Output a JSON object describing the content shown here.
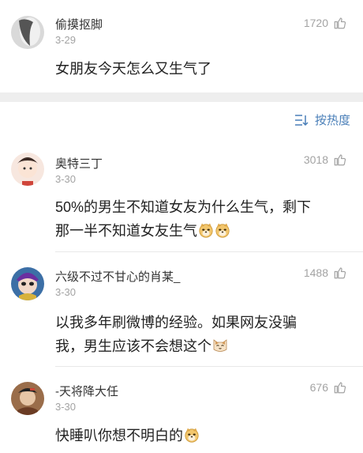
{
  "sort": {
    "label": "按热度",
    "icon": "sort-icon"
  },
  "top_comment": {
    "user": "偷摸抠脚",
    "date": "3-29",
    "likes": "1720",
    "text": "女朋友今天怎么又生气了"
  },
  "comments": [
    {
      "user": "奥特三丁",
      "date": "3-30",
      "likes": "3018",
      "text_line1": "50%的男生不知道女友为什么生气，剩下",
      "text_line2": "那一半不知道女友生气",
      "emojis": [
        "doge-emoji",
        "doge-emoji"
      ]
    },
    {
      "user": "六级不过不甘心的肖某_",
      "date": "3-30",
      "likes": "1488",
      "text_line1": "以我多年刷微博的经验。如果网友没骗",
      "text_line2": "我，男生应该不会想这个",
      "emojis": [
        "cat-emoji"
      ]
    },
    {
      "user": "-天将降大任",
      "date": "3-30",
      "likes": "676",
      "text_line1": "快睡叭你想不明白的",
      "emojis": [
        "doge-emoji"
      ]
    }
  ],
  "colors": {
    "accent": "#4a7fb8",
    "muted": "#a3a3a3",
    "text": "#222222"
  }
}
